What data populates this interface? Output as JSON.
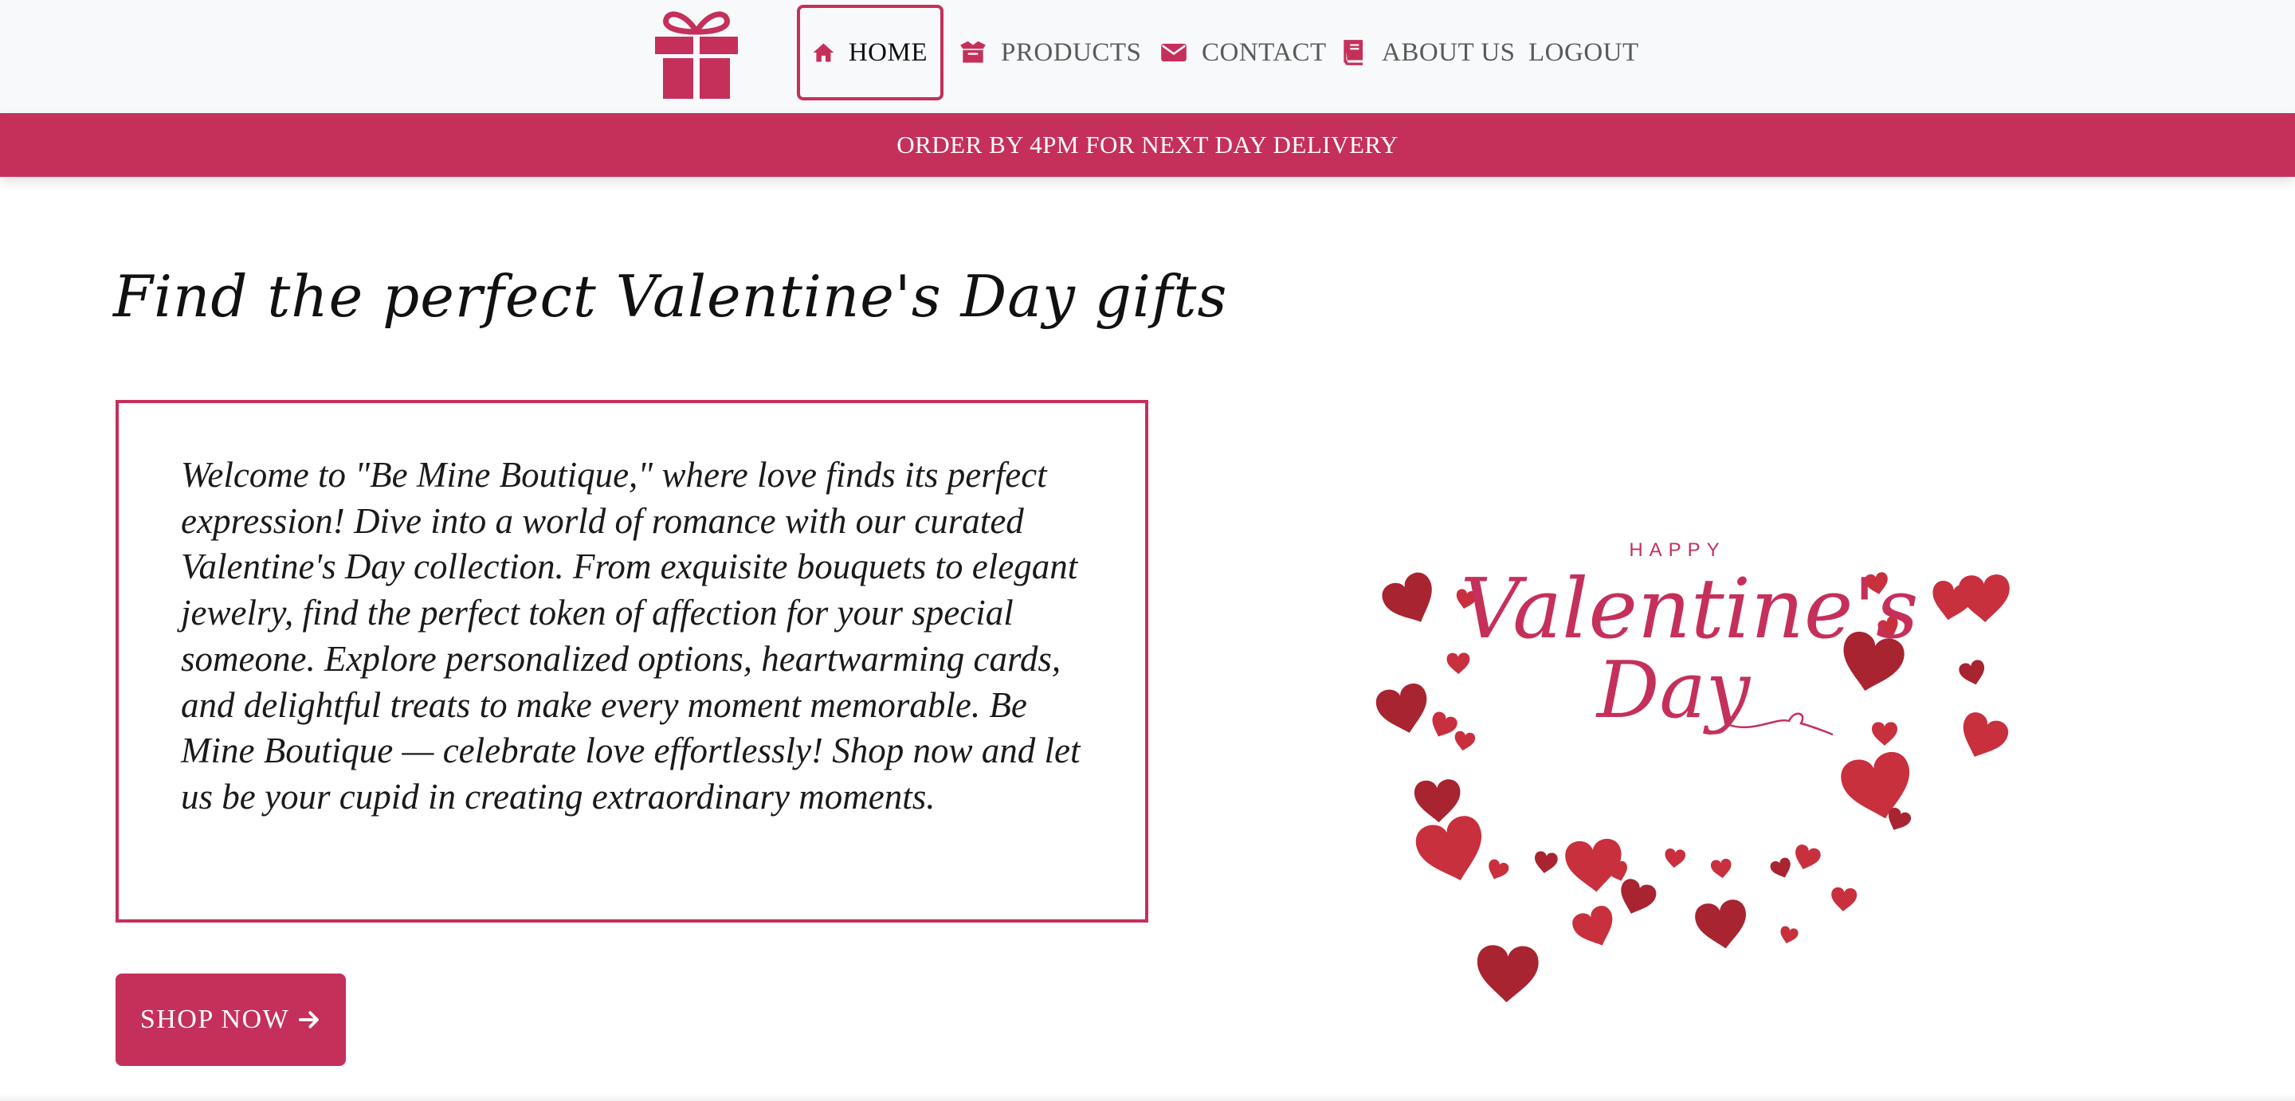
{
  "nav": {
    "logo_icon": "gift-icon",
    "items": [
      {
        "label": "HOME",
        "icon": "home-icon",
        "active": true
      },
      {
        "label": "PRODUCTS",
        "icon": "box-icon"
      },
      {
        "label": "CONTACT",
        "icon": "envelope-icon"
      },
      {
        "label": "ABOUT US",
        "icon": "book-icon"
      },
      {
        "label": "LOGOUT"
      }
    ]
  },
  "promo": {
    "text": "ORDER BY 4PM FOR NEXT DAY DELIVERY"
  },
  "hero": {
    "title": "Find the perfect Valentine's Day gifts",
    "welcome": "Welcome to \"Be Mine Boutique,\" where love finds its perfect expression! Dive into a world of romance with our curated Valentine's Day collection. From exquisite bouquets to elegant jewelry, find the perfect token of affection for your special someone. Explore personalized options, heartwarming cards, and delightful treats to make every moment memorable. Be Mine Boutique — celebrate love effortlessly! Shop now and let us be your cupid in creating extraordinary moments.",
    "cta_label": "SHOP NOW",
    "cta_icon": "arrow-right-icon"
  },
  "art": {
    "happy": "HAPPY",
    "line1": "Valentine's",
    "line2": "Day"
  },
  "colors": {
    "accent": "#c5305a",
    "heart": "#c8303e",
    "heart_dark": "#a82431",
    "navbar_bg": "#f8f9fa"
  }
}
